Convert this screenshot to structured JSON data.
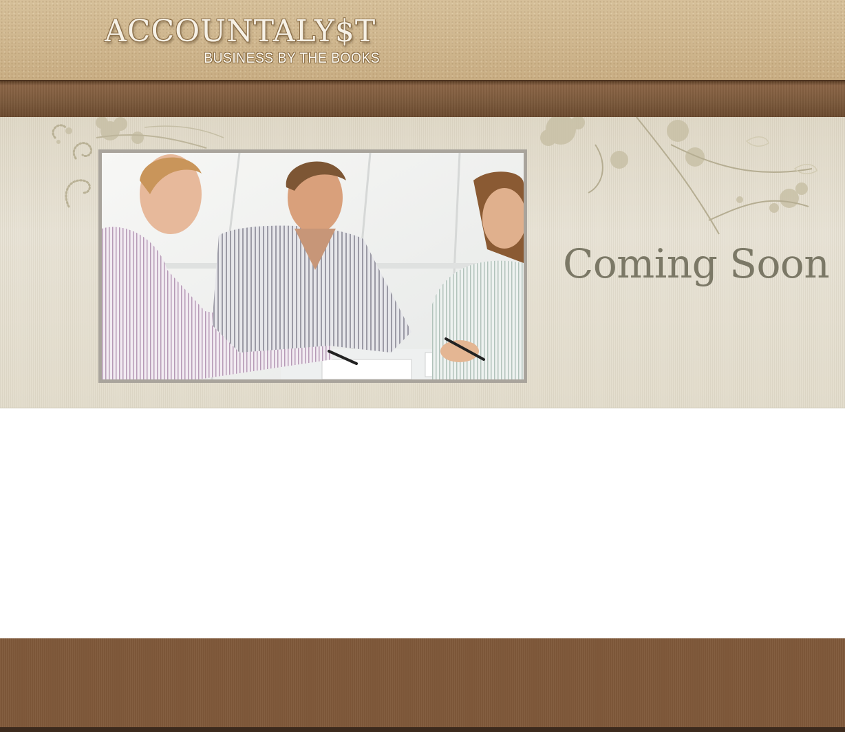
{
  "header": {
    "logo_title": "ACCOUNTALY$T",
    "logo_tagline": "BUSINESS BY THE BOOKS"
  },
  "banner": {
    "photo_description_icon": "business-meeting-photo",
    "headline": "Coming Soon"
  },
  "footer": {
    "links_text": ""
  },
  "colors": {
    "header_bg": "#cdb48c",
    "nav_bg": "#7a5638",
    "banner_bg": "#e6e0d1",
    "headline": "#7b7866",
    "footer_bg": "#80593a"
  }
}
